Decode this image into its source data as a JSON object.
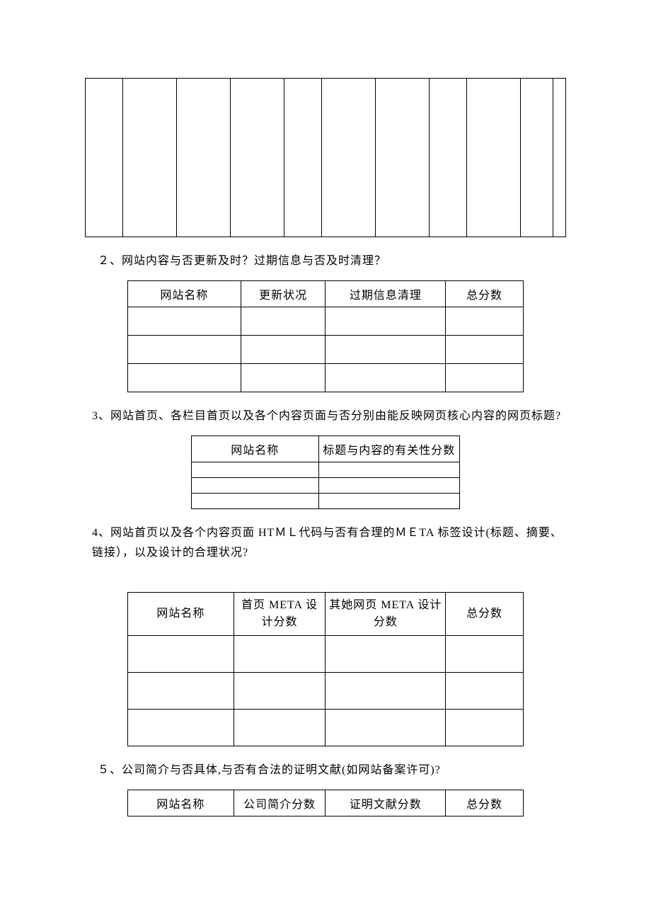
{
  "q2": {
    "text": "２、网站内容与否更新及时？过期信息与否及时清理？",
    "headers": [
      "网站名称",
      "更新状况",
      "过期信息清理",
      "总分数"
    ]
  },
  "q3": {
    "text": "3、网站首页、各栏目首页以及各个内容页面与否分别由能反映网页核心内容的网页标题?",
    "headers": [
      "网站名称",
      "标题与内容的有关性分数"
    ]
  },
  "q4": {
    "text": "4、网站首页以及各个内容页面 HTＭＬ代码与否有合理的ＭＥTA 标签设计(标题、摘要、链接），以及设计的合理状况?",
    "headers": [
      "网站名称",
      "首页 META 设计分数",
      "其她网页 META 设计分数",
      "总分数"
    ]
  },
  "q5": {
    "text": "５、公司简介与否具体,与否有合法的证明文献(如网站备案许可)?",
    "headers": [
      "网站名称",
      "公司简介分数",
      "证明文献分数",
      "总分数"
    ]
  }
}
